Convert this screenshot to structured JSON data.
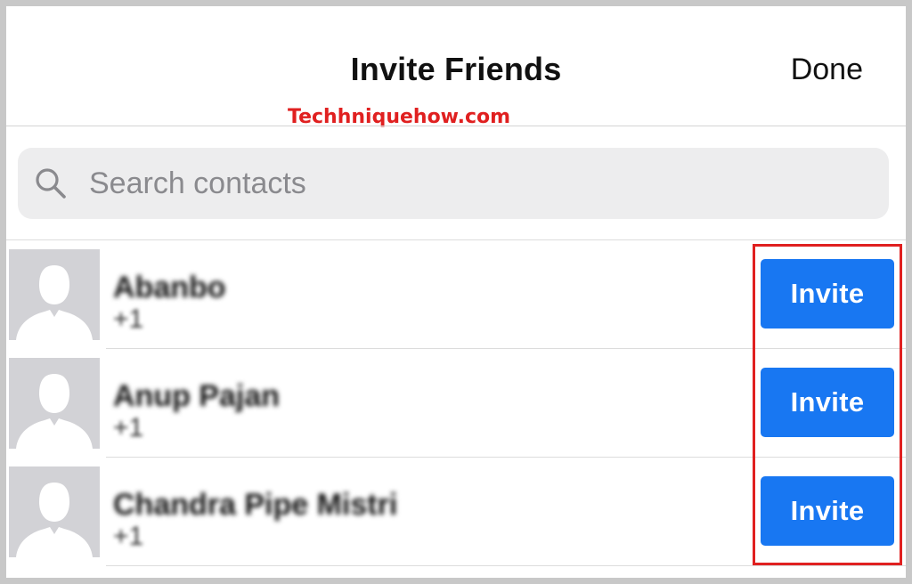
{
  "header": {
    "title": "Invite Friends",
    "done_label": "Done",
    "watermark": "Techhniquehow.com"
  },
  "search": {
    "placeholder": "Search contacts",
    "icon": "search-icon"
  },
  "contacts": [
    {
      "name": "Abanbo",
      "phone": "+1",
      "invite_label": "Invite",
      "avatar_icon": "default-avatar-icon"
    },
    {
      "name": "Anup Pajan",
      "phone": "+1",
      "invite_label": "Invite",
      "avatar_icon": "default-avatar-icon"
    },
    {
      "name": "Chandra Pipe Mistri",
      "phone": "+1",
      "invite_label": "Invite",
      "avatar_icon": "default-avatar-icon"
    }
  ],
  "colors": {
    "accent": "#1877f2",
    "highlight": "#e02020",
    "search_bg": "#ededee"
  }
}
